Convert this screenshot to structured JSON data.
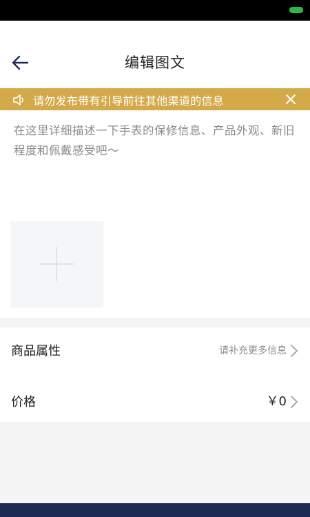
{
  "header": {
    "title": "编辑图文"
  },
  "notice": {
    "text": "请勿发布带有引导前往其他渠道的信息"
  },
  "description": {
    "placeholder": "在这里详细描述一下手表的保修信息、产品外观、新旧程度和佩戴感受吧～"
  },
  "properties_row": {
    "label": "商品属性",
    "hint": "请补充更多信息"
  },
  "price_row": {
    "label": "价格",
    "value": "￥0"
  },
  "colors": {
    "notice_bg": "#d4a94a",
    "bottom_bar": "#1d2b52",
    "battery": "#2fb34a"
  }
}
